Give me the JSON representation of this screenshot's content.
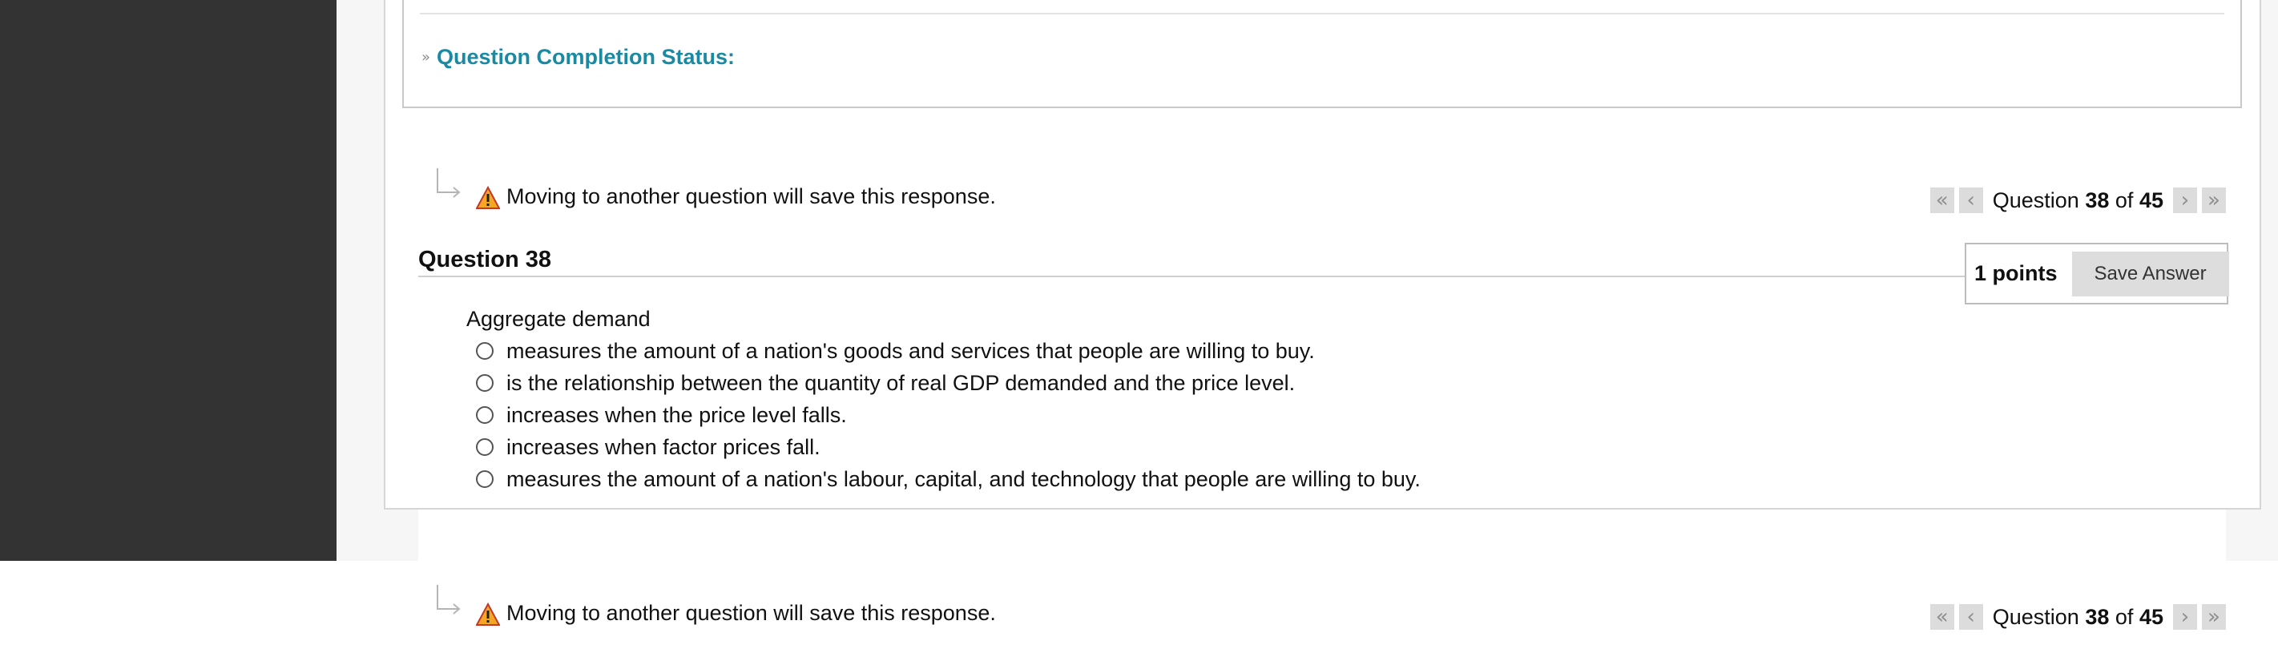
{
  "status": {
    "label": "Question Completion Status:"
  },
  "nav_top": {
    "message": "Moving to another question will save this response.",
    "pager_prefix": "Question",
    "current": "38",
    "of_word": "of",
    "total": "45"
  },
  "question": {
    "title": "Question 38",
    "points": "1 points",
    "save_label": "Save Answer",
    "stem": "Aggregate demand",
    "options": [
      "measures the amount of a nation's goods and services that people are willing to buy.",
      "is the relationship between the quantity of real GDP demanded and the price level.",
      "increases when the price level falls.",
      "increases when factor prices fall.",
      "measures the amount of a nation's labour, capital, and technology that people are willing to buy."
    ]
  },
  "nav_bottom": {
    "message": "Moving to another question will save this response.",
    "pager_prefix": "Question",
    "current": "38",
    "of_word": "of",
    "total": "45"
  },
  "colors": {
    "sidebar": "#333333",
    "link_accent": "#1a8aa3",
    "warning": "#f5a623"
  },
  "icons": {
    "warning": "warning-triangle-icon",
    "first": "double-chevron-left-icon",
    "prev": "chevron-left-icon",
    "next": "chevron-right-icon",
    "last": "double-chevron-right-icon",
    "expand": "double-chevron-down-icon",
    "hook": "hook-arrow-icon"
  }
}
